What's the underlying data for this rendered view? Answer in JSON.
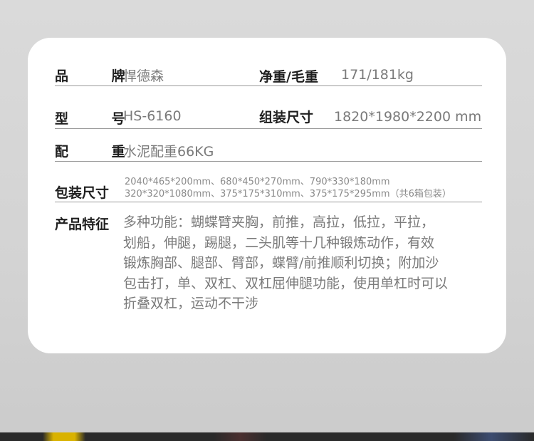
{
  "specs": {
    "brand": {
      "label": "品 牌",
      "value": "悍德森"
    },
    "weight": {
      "label": "净重/毛重",
      "value": "171/181kg"
    },
    "model": {
      "label": "型 号",
      "value": "HS-6160"
    },
    "assembled_size": {
      "label": "组装尺寸",
      "value": "1820*1980*2200 mm"
    },
    "counterweight": {
      "label": "配 重",
      "value": "水泥配重66KG"
    },
    "package_size": {
      "label": "包装尺寸",
      "lines": [
        "2040*465*200mm、680*450*270mm、790*330*180mm",
        "320*320*1080mm、375*175*310mm、375*175*295mm（共6箱包装）"
      ]
    },
    "features": {
      "label": "产品特征",
      "lines": [
        "多种功能：蝴蝶臂夹胸，前推，高拉，低拉，平拉，",
        "划船，伸腿，踢腿，二头肌等十几种锻炼动作，有效",
        "锻炼胸部、腿部、臂部，蝶臂/前推顺利切换；附加沙",
        "包击打，单、双杠、双杠屈伸腿功能，使用单杠时可以",
        "折叠双杠，运动不干涉"
      ]
    }
  }
}
